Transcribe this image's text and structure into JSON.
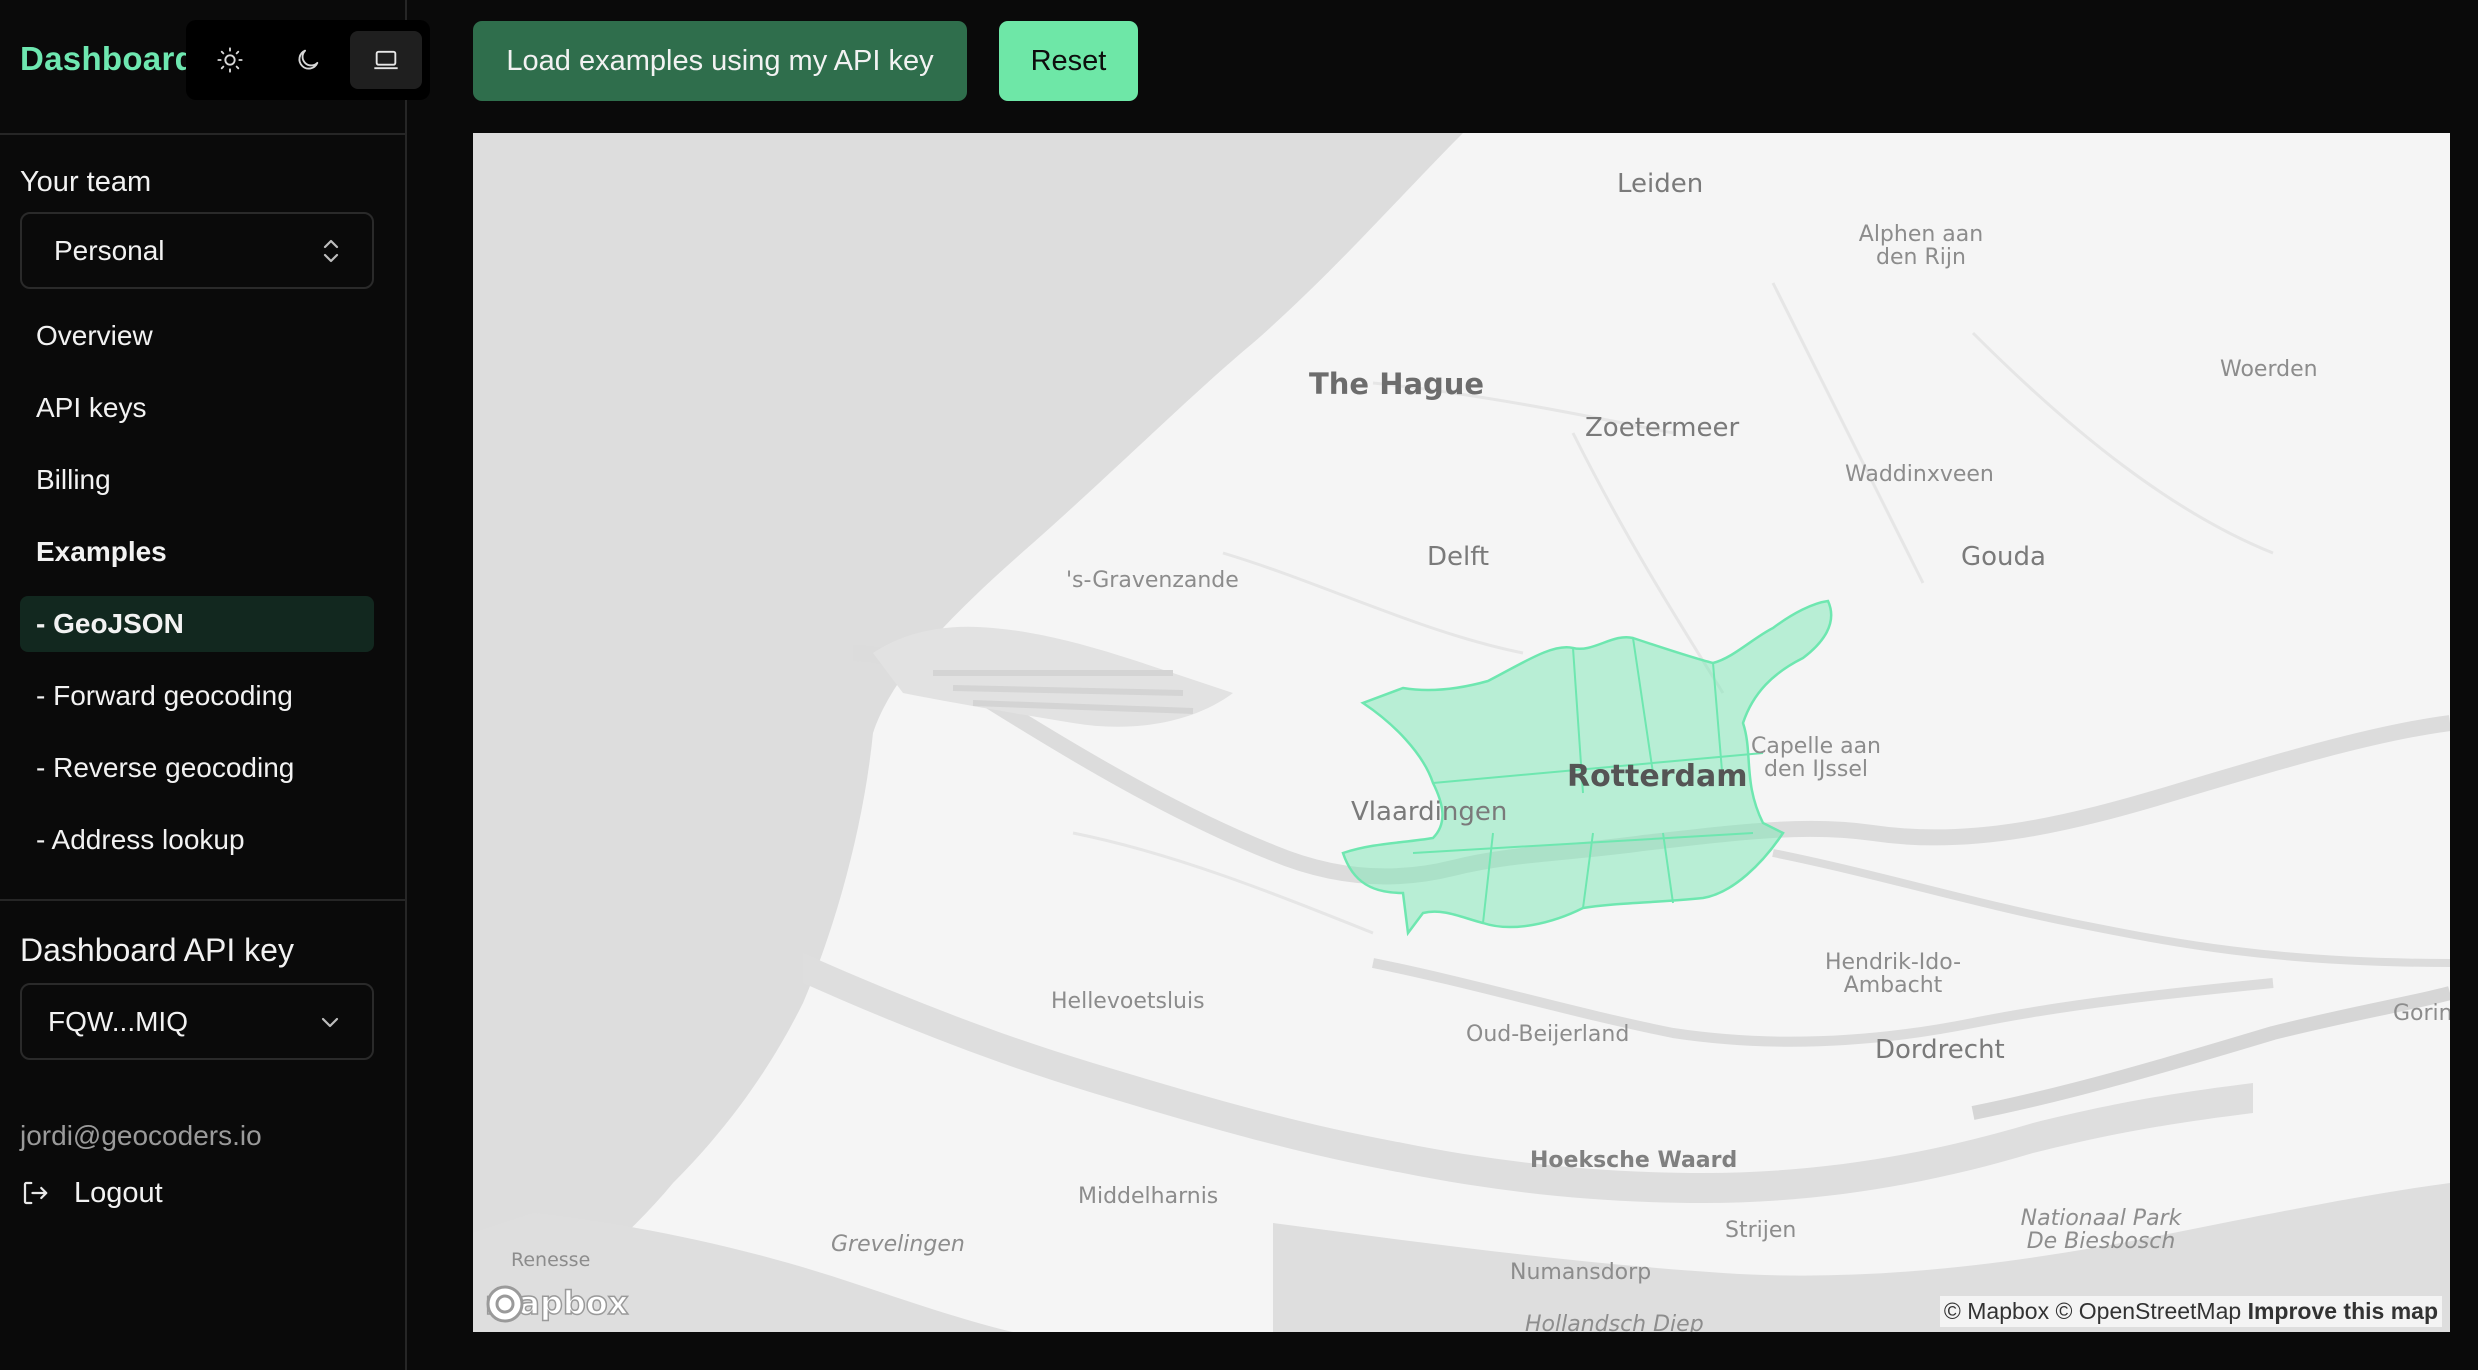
{
  "sidebar": {
    "brand": "Dashboard",
    "theme_options": [
      "light-mode",
      "dark-mode",
      "system-mode"
    ],
    "team_label": "Your team",
    "team_value": "Personal",
    "nav": [
      {
        "label": "Overview"
      },
      {
        "label": "API keys"
      },
      {
        "label": "Billing"
      },
      {
        "label": "Examples"
      },
      {
        "label": "- GeoJSON"
      },
      {
        "label": "- Forward geocoding"
      },
      {
        "label": "- Reverse geocoding"
      },
      {
        "label": "- Address lookup"
      }
    ],
    "active_item": "- GeoJSON",
    "api_key_label": "Dashboard API key",
    "api_key_value": "FQW...MIQ",
    "user_email": "jordi@geocoders.io",
    "logout_label": "Logout"
  },
  "toolbar": {
    "load_label": "Load examples using my API key",
    "reset_label": "Reset"
  },
  "map": {
    "places": {
      "leiden": "Leiden",
      "alphen": "Alphen aan den Rijn",
      "woerden": "Woerden",
      "the_hague": "The Hague",
      "zoetermeer": "Zoetermeer",
      "waddinxveen": "Waddinxveen",
      "delft": "Delft",
      "gouda": "Gouda",
      "gravenzande": "'s-Gravenzande",
      "capelle": "Capelle aan den IJssel",
      "rotterdam": "Rotterdam",
      "vlaardingen": "Vlaardingen",
      "hendrik": "Hendrik-Ido-Ambacht",
      "hellevoetsluis": "Hellevoetsluis",
      "oud_beijerland": "Oud-Beijerland",
      "dordrecht": "Dordrecht",
      "gorinchem": "Gorinche",
      "hoeksche_waard": "Hoeksche Waard",
      "middelharnis": "Middelharnis",
      "strijen": "Strijen",
      "biesbosch": "Nationaal Park De Biesbosch",
      "renesse": "Renesse",
      "grevelingen": "Grevelingen",
      "numansdorp": "Numansdorp",
      "hollandsch_diep": "Hollandsch Diep"
    },
    "logo_text": "mapbox",
    "attribution": "© Mapbox © OpenStreetMap",
    "improve_link": "Improve this map",
    "highlight_color": "#6ee7b0",
    "water_color": "#dddddd",
    "land_color": "#f5f5f5"
  }
}
